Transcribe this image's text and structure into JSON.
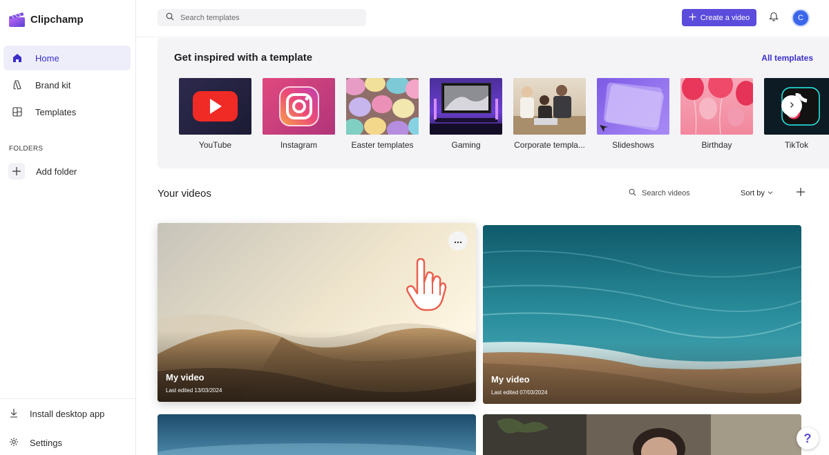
{
  "app": {
    "name": "Clipchamp"
  },
  "sidebar": {
    "items": [
      {
        "label": "Home",
        "icon": "home-icon",
        "active": true
      },
      {
        "label": "Brand kit",
        "icon": "brand-kit-icon"
      },
      {
        "label": "Templates",
        "icon": "templates-icon"
      }
    ],
    "folders_label": "FOLDERS",
    "add_folder_label": "Add folder",
    "install_label": "Install desktop app",
    "settings_label": "Settings"
  },
  "topbar": {
    "search_placeholder": "Search templates",
    "create_label": "Create a video",
    "avatar_initial": "C"
  },
  "templates": {
    "title": "Get inspired with a template",
    "all_label": "All templates",
    "items": [
      {
        "label": "YouTube"
      },
      {
        "label": "Instagram"
      },
      {
        "label": "Easter templates"
      },
      {
        "label": "Gaming"
      },
      {
        "label": "Corporate templa..."
      },
      {
        "label": "Slideshows"
      },
      {
        "label": "Birthday"
      },
      {
        "label": "TikTok"
      }
    ]
  },
  "videos": {
    "title": "Your videos",
    "search_placeholder": "Search videos",
    "sort_label": "Sort by",
    "items": [
      {
        "title": "My video",
        "date": "Last edited 13/03/2024"
      },
      {
        "title": "My video",
        "date": "Last edited 07/03/2024"
      }
    ]
  },
  "help": {
    "label": "?"
  },
  "colors": {
    "accent": "#5b4cdc",
    "active_bg": "#eeeefb",
    "link": "#3b2fc9"
  }
}
